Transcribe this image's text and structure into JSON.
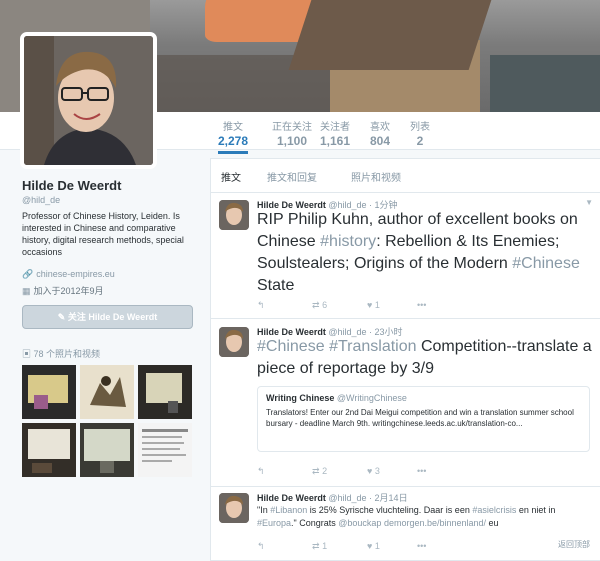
{
  "profile": {
    "name": "Hilde De Weerdt",
    "handle": "@hild_de",
    "bio": "Professor of Chinese History, Leiden. Is interested in Chinese and comparative history, digital research methods, special occasions",
    "website": "chinese-empires.eu",
    "joined": "加入于2012年9月",
    "follow_label": "关注 Hilde De Weerdt",
    "photos_label": "78 个照片和视频"
  },
  "stats": [
    {
      "label": "推文",
      "value": "2,278"
    },
    {
      "label": "正在关注",
      "value": "1,100"
    },
    {
      "label": "关注者",
      "value": "1,161"
    },
    {
      "label": "喜欢",
      "value": "804"
    },
    {
      "label": "列表",
      "value": "2"
    }
  ],
  "tabs": [
    "推文",
    "推文和回复",
    "照片和视频"
  ],
  "tweets": [
    {
      "author": "Hilde De Weerdt",
      "handle": "@hild_de",
      "time": "1分钟",
      "text_parts": [
        "RIP Philip Kuhn, author of excellent books on Chinese ",
        "#history",
        ": Rebellion & Its Enemies; Soulstealers; Origins of the Modern ",
        "#Chinese",
        " State"
      ],
      "retweets": "6",
      "likes": "1"
    },
    {
      "author": "Hilde De Weerdt",
      "handle": "@hild_de",
      "time": "23小时",
      "text_parts": [
        "#Chinese",
        " ",
        "#Translation",
        " Competition--translate a piece of reportage by 3/9"
      ],
      "card_title": "Writing Chinese",
      "card_handle": "@WritingChinese",
      "card_text": "Translators! Enter our 2nd Dai Meigui competition and win a translation summer school bursary - deadline March 9th. writingchinese.leeds.ac.uk/translation-co...",
      "retweets": "2",
      "likes": "3"
    },
    {
      "author": "Hilde De Weerdt",
      "handle": "@hild_de",
      "time": "2月14日",
      "text_parts": [
        "\"In ",
        "#Libanon",
        " is 25% Syrische vluchteling. Daar is een ",
        "#asielcrisis",
        " en niet in ",
        "#Europa",
        ".\" Congrats ",
        "@bouckap",
        " ",
        "demorgen.be/binnenland/",
        " eu"
      ],
      "retweets": "1",
      "likes": "1"
    }
  ],
  "scroll_top": "返回顶部",
  "colors": {
    "accent": "#2b7bb9",
    "muted": "#8899a6",
    "hashtag": "#8899a6"
  }
}
